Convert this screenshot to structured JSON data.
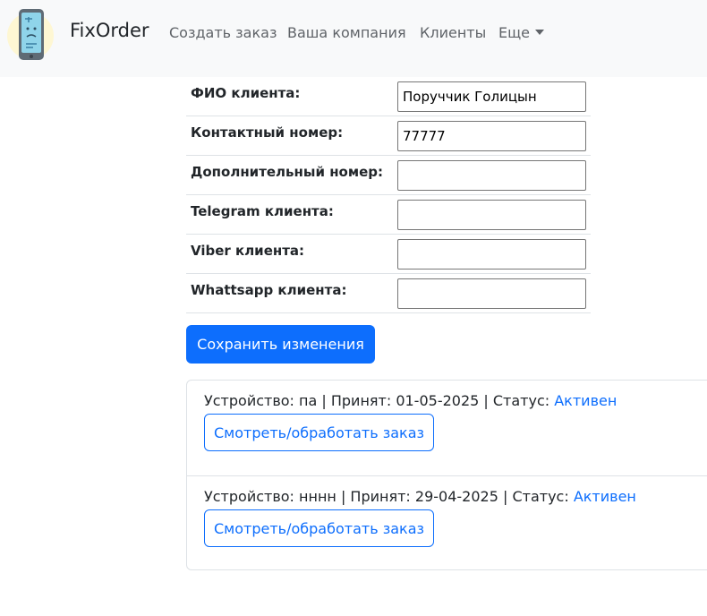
{
  "navbar": {
    "brand": "FixOrder",
    "links": [
      "Создать заказ",
      "Ваша компания",
      "Клиенты",
      "Еще"
    ]
  },
  "form": {
    "rows": [
      {
        "label": "ФИО клиента:",
        "value": "Поруччик Голицын"
      },
      {
        "label": "Контактный номер:",
        "value": "77777"
      },
      {
        "label": "Дополнительный номер:",
        "value": ""
      },
      {
        "label": "Telegram клиента:",
        "value": ""
      },
      {
        "label": "Viber клиента:",
        "value": ""
      },
      {
        "label": "Whattsapp клиента:",
        "value": ""
      }
    ],
    "save_label": "Сохранить изменения"
  },
  "orders": [
    {
      "prefix": "Устройство: па | Принят: 01-05-2025 | Статус: ",
      "status": "Активен",
      "button": "Смотреть/обработать заказ"
    },
    {
      "prefix": "Устройство: нннн | Принят: 29-04-2025 | Статус: ",
      "status": "Активен",
      "button": "Смотреть/обработать заказ"
    }
  ],
  "colors": {
    "primary": "#0d6efd",
    "navbar_bg": "#f8f9fa",
    "border": "#dee2e6"
  }
}
